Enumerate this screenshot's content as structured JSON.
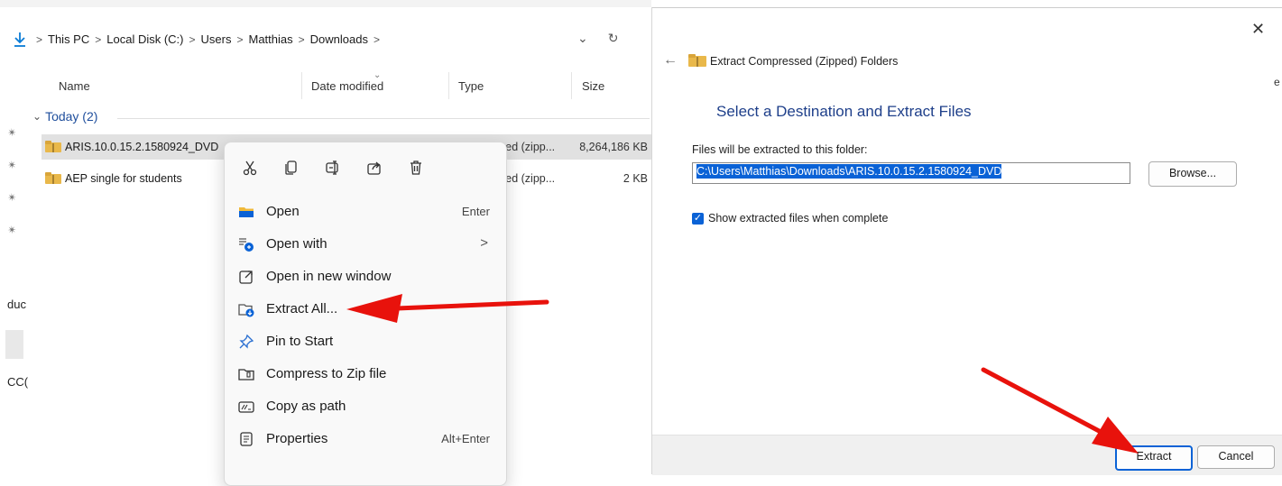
{
  "explorer": {
    "breadcrumb": [
      "This PC",
      "Local Disk (C:)",
      "Users",
      "Matthias",
      "Downloads"
    ],
    "columns": {
      "name": "Name",
      "date_modified": "Date modified",
      "type": "Type",
      "size": "Size"
    },
    "group_label": "Today (2)",
    "files": [
      {
        "name": "ARIS.10.0.15.2.1580924_DVD",
        "type": "sed (zipp...",
        "size": "8,264,186 KB",
        "selected": true
      },
      {
        "name": "AEP single for students",
        "type": "sed (zipp...",
        "size": "2 KB",
        "selected": false
      }
    ],
    "left_fragments": {
      "a": "duc",
      "b": "CC("
    }
  },
  "context_menu": {
    "quick_actions": [
      "cut-icon",
      "copy-icon",
      "rename-icon",
      "share-icon",
      "delete-icon"
    ],
    "items": [
      {
        "label": "Open",
        "shortcut": "Enter",
        "icon": "folder-open-icon"
      },
      {
        "label": "Open with",
        "shortcut": "",
        "icon": "open-with-icon",
        "submenu": ">"
      },
      {
        "label": "Open in new window",
        "shortcut": "",
        "icon": "new-window-icon"
      },
      {
        "label": "Extract All...",
        "shortcut": "",
        "icon": "extract-icon"
      },
      {
        "label": "Pin to Start",
        "shortcut": "",
        "icon": "pin-icon"
      },
      {
        "label": "Compress to Zip file",
        "shortcut": "",
        "icon": "zip-icon"
      },
      {
        "label": "Copy as path",
        "shortcut": "",
        "icon": "copy-path-icon"
      },
      {
        "label": "Properties",
        "shortcut": "Alt+Enter",
        "icon": "properties-icon"
      }
    ]
  },
  "dialog": {
    "window_title": "Extract Compressed (Zipped) Folders",
    "heading": "Select a Destination and Extract Files",
    "folder_label": "Files will be extracted to this folder:",
    "destination_path": "C:\\Users\\Matthias\\Downloads\\ARIS.10.0.15.2.1580924_DVD",
    "browse_label": "Browse...",
    "show_files_label": "Show extracted files when complete",
    "show_files_checked": true,
    "extract_label": "Extract",
    "cancel_label": "Cancel"
  },
  "colors": {
    "accent": "#0a62d6",
    "arrow": "#e8120c",
    "heading": "#1e3f8a",
    "selection": "#e1e1e1"
  }
}
